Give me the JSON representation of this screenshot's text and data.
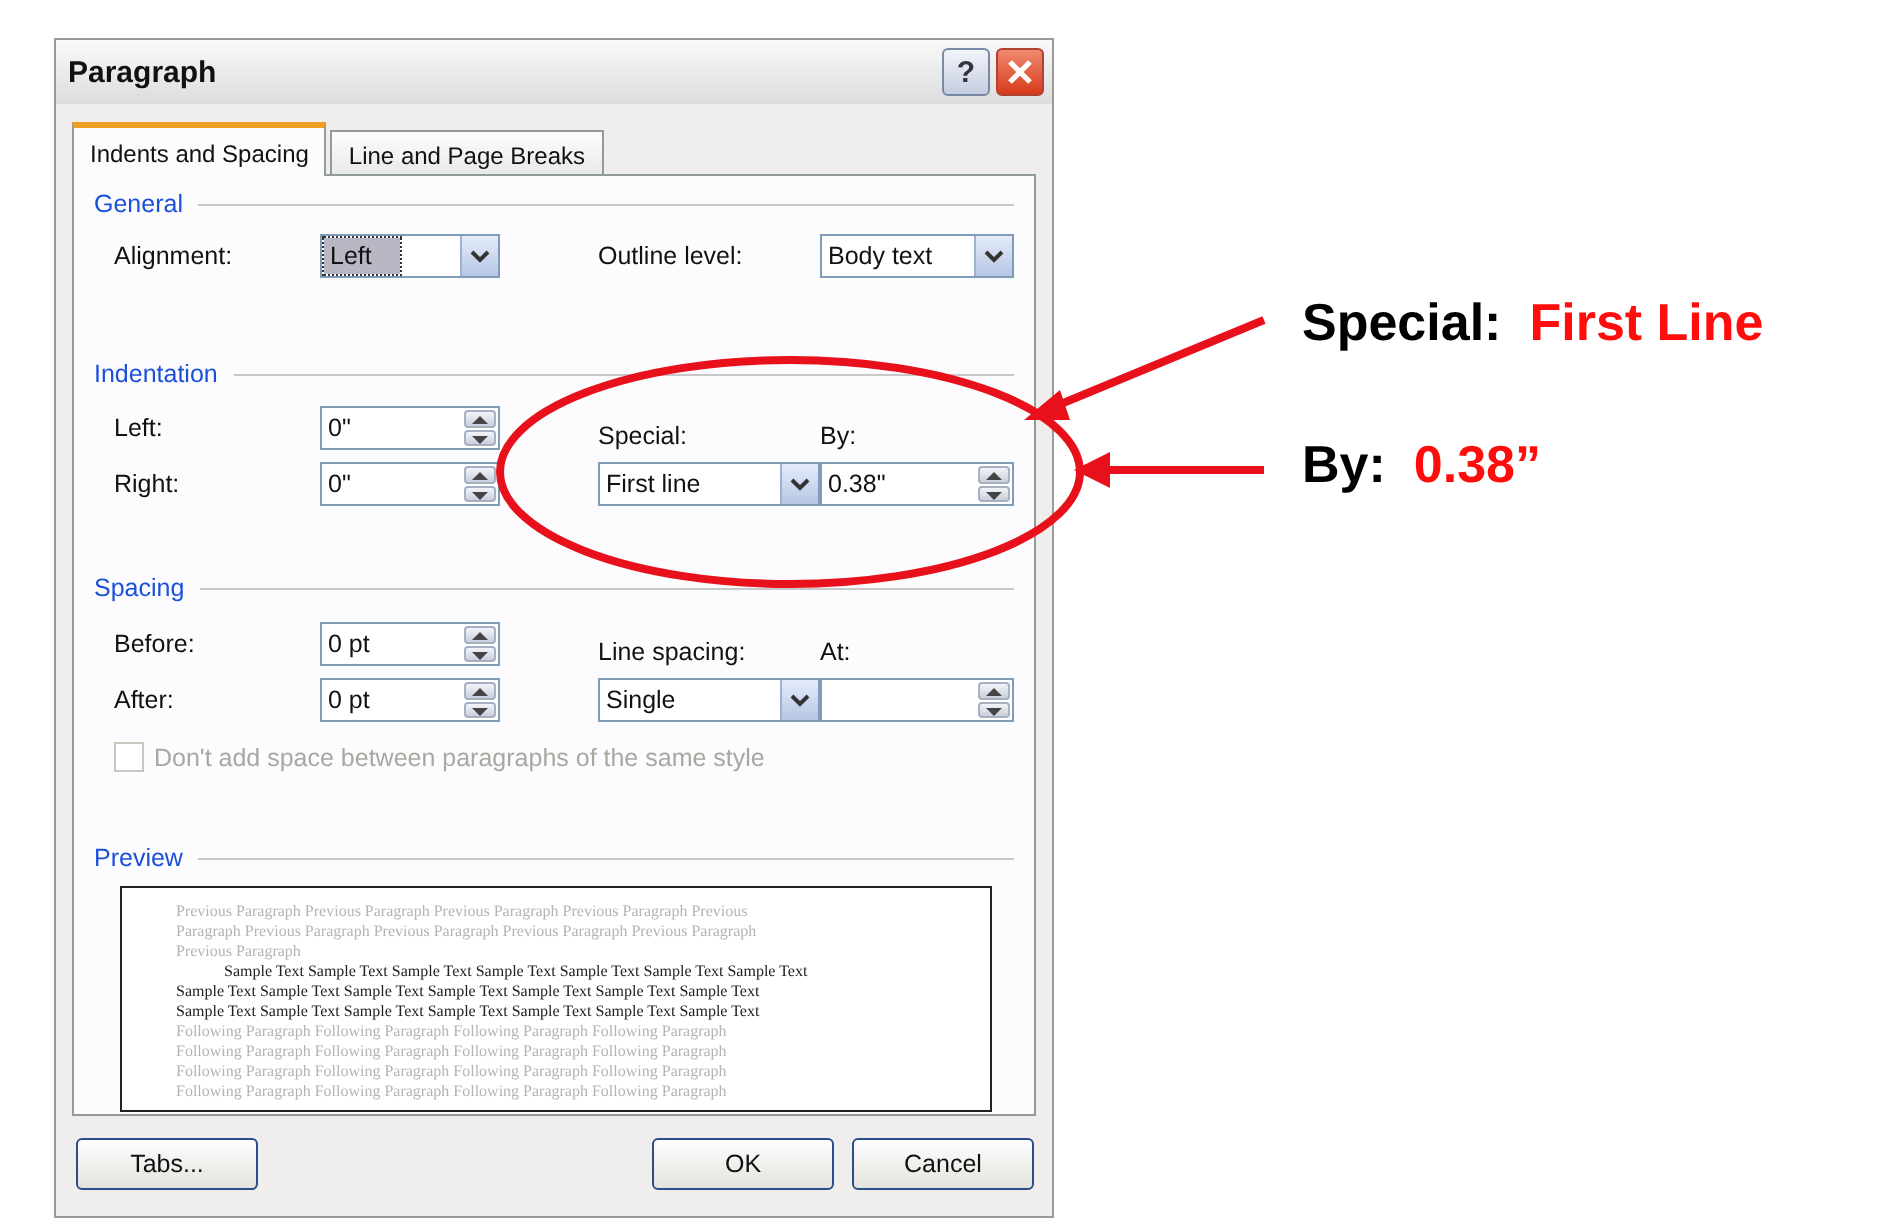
{
  "dialog": {
    "title": "Paragraph",
    "help": "?"
  },
  "tabs": [
    {
      "label": "Indents and Spacing",
      "selected": true
    },
    {
      "label": "Line and Page Breaks",
      "selected": false
    }
  ],
  "general": {
    "heading": "General",
    "alignment": {
      "label": "Alignment:",
      "value": "Left",
      "focused": true
    },
    "outline_level": {
      "label": "Outline level:",
      "value": "Body text",
      "focused": false
    }
  },
  "indentation": {
    "heading": "Indentation",
    "left": {
      "label": "Left:",
      "value": "0\""
    },
    "right": {
      "label": "Right:",
      "value": "0\""
    },
    "special": {
      "label": "Special:",
      "value": "First line"
    },
    "by": {
      "label": "By:",
      "value": "0.38\""
    }
  },
  "spacing": {
    "heading": "Spacing",
    "before": {
      "label": "Before:",
      "value": "0 pt"
    },
    "after": {
      "label": "After:",
      "value": "0 pt"
    },
    "line_spacing": {
      "label": "Line spacing:",
      "value": "Single"
    },
    "at": {
      "label": "At:"
    },
    "dont_add_space": {
      "label": "Don't add space between paragraphs of the same style",
      "checked": false,
      "disabled": true
    }
  },
  "preview": {
    "heading": "Preview",
    "lines": [
      {
        "kind": "previous",
        "text": "Previous Paragraph Previous Paragraph Previous Paragraph Previous Paragraph Previous"
      },
      {
        "kind": "previous",
        "text": "Paragraph Previous Paragraph Previous Paragraph Previous Paragraph Previous Paragraph"
      },
      {
        "kind": "previous",
        "text": "Previous Paragraph"
      },
      {
        "kind": "first",
        "text": "Sample Text Sample Text Sample Text Sample Text Sample Text Sample Text Sample Text"
      },
      {
        "kind": "sample",
        "text": "Sample Text Sample Text Sample Text Sample Text Sample Text Sample Text Sample Text"
      },
      {
        "kind": "sample",
        "text": "Sample Text Sample Text Sample Text Sample Text Sample Text Sample Text Sample Text"
      },
      {
        "kind": "following",
        "text": "Following Paragraph Following Paragraph Following Paragraph Following Paragraph"
      },
      {
        "kind": "following",
        "text": "Following Paragraph Following Paragraph Following Paragraph Following Paragraph"
      },
      {
        "kind": "following",
        "text": "Following Paragraph Following Paragraph Following Paragraph Following Paragraph"
      },
      {
        "kind": "following",
        "text": "Following Paragraph Following Paragraph Following Paragraph Following Paragraph"
      }
    ]
  },
  "tabs_button": {
    "label": "Tabs..."
  },
  "buttons": [
    {
      "label": "OK"
    },
    {
      "label": "Cancel"
    }
  ],
  "annotations": [
    {
      "label": "Special:",
      "value": "First Line"
    },
    {
      "label": "By:",
      "value": "0.38”"
    }
  ]
}
